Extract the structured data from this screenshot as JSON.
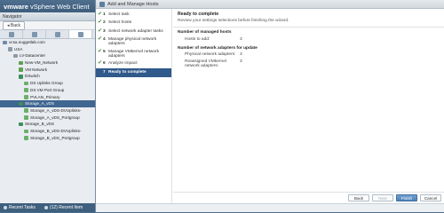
{
  "app": {
    "brand": "vmware",
    "product": "vSphere Web Client"
  },
  "navigator": {
    "title": "Navigator",
    "back_label": "Back",
    "tree": [
      {
        "label": "vcsa.nuggetlab.com",
        "icon": "vcenter-icon",
        "indent": 0
      },
      {
        "label": "USA",
        "icon": "datacenter-icon",
        "indent": 1
      },
      {
        "label": "LV-Datacenter",
        "icon": "datacenter-icon",
        "indent": 2
      },
      {
        "label": "New-VM_Network",
        "icon": "network-icon",
        "indent": 3
      },
      {
        "label": "VM Network",
        "icon": "network-icon",
        "indent": 3
      },
      {
        "label": "DSwitch",
        "icon": "dswitch-icon",
        "indent": 3
      },
      {
        "label": "DS Uplinks Group",
        "icon": "portgroup-icon",
        "indent": 4
      },
      {
        "label": "DS VM Port Group",
        "icon": "portgroup-icon",
        "indent": 4
      },
      {
        "label": "PVLAN_Primary",
        "icon": "portgroup-icon",
        "indent": 4
      },
      {
        "label": "Storage_A_vDS",
        "icon": "dswitch-icon",
        "indent": 3,
        "selected": true
      },
      {
        "label": "Storage_A_vDS-DVUplinks-",
        "icon": "portgroup-icon",
        "indent": 4
      },
      {
        "label": "Storage_A_vDS_Portgroup",
        "icon": "portgroup-icon",
        "indent": 4
      },
      {
        "label": "Storage_B_vDS",
        "icon": "dswitch-icon",
        "indent": 3
      },
      {
        "label": "Storage_B_vDS-DVUplinks-",
        "icon": "portgroup-icon",
        "indent": 4
      },
      {
        "label": "Storage_B_vDS_Portgroup",
        "icon": "portgroup-icon",
        "indent": 4
      }
    ]
  },
  "bottom_bar": {
    "recent_tasks": "Recent Tasks",
    "alarms": "(12) Recent Item"
  },
  "dialog": {
    "title": "Add and Manage Hosts",
    "steps": [
      {
        "num": "1",
        "label": "Select task",
        "done": true
      },
      {
        "num": "2",
        "label": "Select hosts",
        "done": true
      },
      {
        "num": "3",
        "label": "Select network adapter tasks",
        "done": true
      },
      {
        "num": "4",
        "label": "Manage physical network adapters",
        "done": true
      },
      {
        "num": "5",
        "label": "Manage VMkernel network adapters",
        "done": true
      },
      {
        "num": "6",
        "label": "Analyze impact",
        "done": true
      },
      {
        "num": "7",
        "label": "Ready to complete",
        "done": false,
        "current": true
      }
    ],
    "content": {
      "heading": "Ready to complete",
      "description": "Review your settings selections before finishing the wizard.",
      "managed_hosts_title": "Number of managed hosts",
      "hosts_to_add_label": "Hosts to add:",
      "hosts_to_add_value": "3",
      "adapters_title": "Number of network adapters for update",
      "physical_label": "Physical network adapters:",
      "physical_value": "3",
      "vmkernel_label": "Reassigned VMkernel network adapters:",
      "vmkernel_value": "3"
    },
    "buttons": {
      "back": "Back",
      "next": "Next",
      "finish": "Finish",
      "cancel": "Cancel"
    }
  }
}
